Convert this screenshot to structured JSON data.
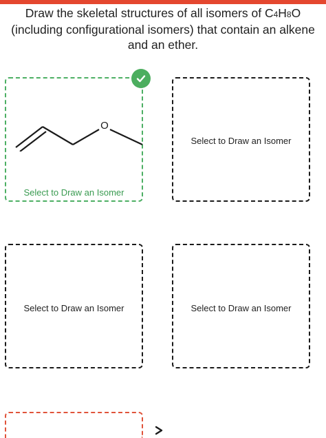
{
  "question": {
    "prefix": "Draw the skeletal structures of all isomers of C",
    "sub1": "4",
    "mid1": "H",
    "sub2": "8",
    "suffix": "O (including configurational isomers) that contain an alkene and an ether."
  },
  "boxes": [
    {
      "label": "Select to Draw an Isomer",
      "state": "completed"
    },
    {
      "label": "Select to Draw an Isomer",
      "state": "empty"
    },
    {
      "label": "Select to Draw an Isomer",
      "state": "empty"
    },
    {
      "label": "Select to Draw an Isomer",
      "state": "empty"
    }
  ],
  "molecule": {
    "atom_label": "O"
  },
  "colors": {
    "accent_red": "#e4472f",
    "success_green": "#4cae5f"
  },
  "icons": {
    "badge": "checkmark-icon",
    "scroll": "chevron-down-icon"
  }
}
